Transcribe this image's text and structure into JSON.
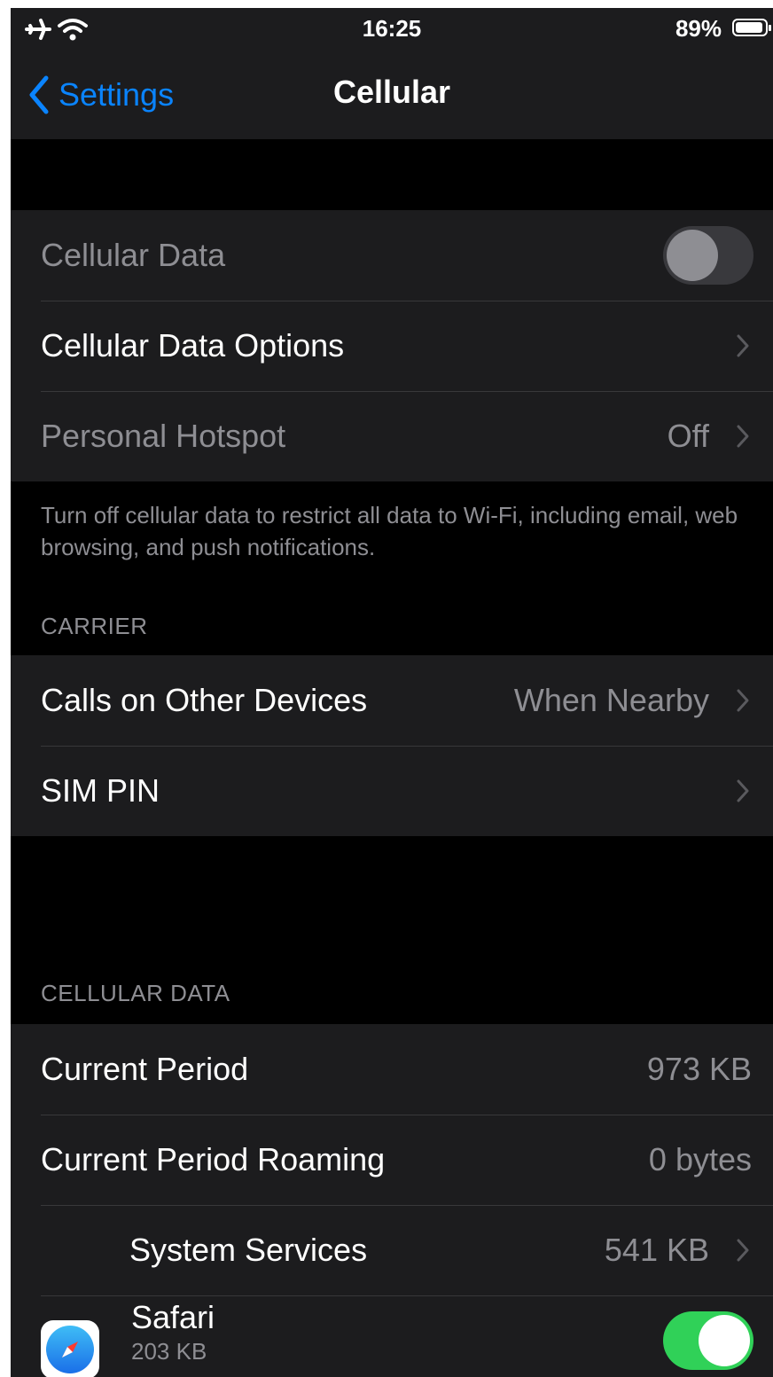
{
  "status_bar": {
    "time": "16:25",
    "battery_percent": "89%",
    "battery_level": 0.89
  },
  "nav": {
    "back_label": "Settings",
    "title": "Cellular"
  },
  "group1": {
    "cellular_data": {
      "label": "Cellular Data",
      "enabled": false
    },
    "cellular_data_options": {
      "label": "Cellular Data Options"
    },
    "personal_hotspot": {
      "label": "Personal Hotspot",
      "value": "Off"
    }
  },
  "group1_footer": "Turn off cellular data to restrict all data to Wi-Fi, including email, web browsing, and push notifications.",
  "carrier": {
    "header": "CARRIER",
    "calls_on_other_devices": {
      "label": "Calls on Other Devices",
      "value": "When Nearby"
    },
    "sim_pin": {
      "label": "SIM PIN"
    }
  },
  "cellular_data_section": {
    "header": "CELLULAR DATA",
    "current_period": {
      "label": "Current Period",
      "value": "973 KB"
    },
    "current_period_roaming": {
      "label": "Current Period Roaming",
      "value": "0 bytes"
    },
    "system_services": {
      "label": "System Services",
      "value": "541 KB"
    },
    "safari": {
      "label": "Safari",
      "sub": "203 KB",
      "enabled": true
    }
  },
  "colors": {
    "accent": "#0a84ff",
    "toggle_on": "#30d158",
    "background": "#000000",
    "cell": "#1c1c1e"
  }
}
